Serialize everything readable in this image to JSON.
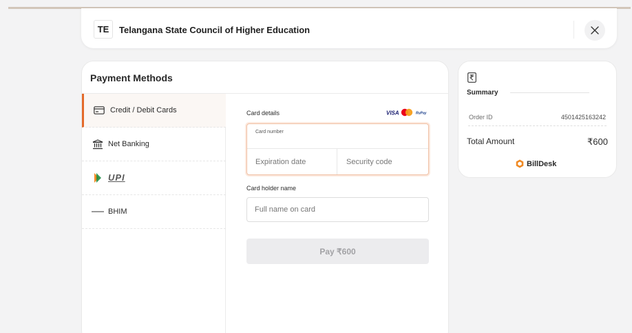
{
  "header": {
    "logo_initials": "TE",
    "org_name": "Telangana State Council of Higher Education",
    "close_icon": "close-icon"
  },
  "payment": {
    "title": "Payment Methods",
    "methods": [
      {
        "label": "Credit / Debit Cards",
        "icon": "card-icon",
        "active": true
      },
      {
        "label": "Net Banking",
        "icon": "bank-icon",
        "active": false
      },
      {
        "label": "",
        "icon": "upi-logo",
        "logo_text": "UPI",
        "active": false
      },
      {
        "label": "BHIM",
        "icon": "bhim-logo",
        "logo_text": "BHIM",
        "active": false
      }
    ],
    "card_details_label": "Card details",
    "brand_logos": [
      "VISA",
      "Mastercard",
      "RuPay"
    ],
    "card_number_label": "Card number",
    "expiration_placeholder": "Expiration date",
    "security_placeholder": "Security code",
    "holder_label": "Card holder name",
    "holder_placeholder": "Full name on card",
    "pay_button": "Pay ₹600"
  },
  "summary": {
    "icon": "rupee-receipt-icon",
    "title": "Summary",
    "order_id_label": "Order ID",
    "order_id": "4501425163242",
    "total_label": "Total Amount",
    "total_amount": "₹600",
    "powered_by": "BillDesk"
  },
  "colors": {
    "accent": "#e46a2a",
    "focus_border": "#f0bfa3",
    "pay_disabled_bg": "#ececee",
    "page_bg": "#f3f3f4"
  }
}
